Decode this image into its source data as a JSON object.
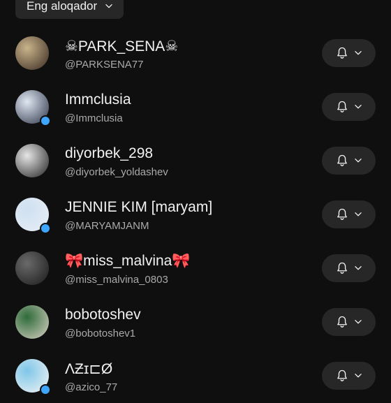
{
  "sort": {
    "label": "Eng aloqador"
  },
  "channels": [
    {
      "name": "☠PARK_SENA☠",
      "handle": "@PARKSENA77",
      "has_dot": false,
      "avatar_colors": [
        "#c9b48a",
        "#3a2a22"
      ]
    },
    {
      "name": "Immclusia",
      "handle": "@Immclusia",
      "has_dot": true,
      "avatar_colors": [
        "#dfe7f2",
        "#2c3346"
      ]
    },
    {
      "name": "diyorbek_298",
      "handle": "@diyorbek_yoldashev",
      "has_dot": false,
      "avatar_colors": [
        "#e6e6e6",
        "#222222"
      ]
    },
    {
      "name": "JENNIE KIM [maryam]",
      "handle": "@MARYAMJANM",
      "has_dot": true,
      "avatar_colors": [
        "#cfe0f0",
        "#e8eef6"
      ]
    },
    {
      "name": "🎀miss_malvina🎀",
      "handle": "@miss_malvina_0803",
      "has_dot": false,
      "avatar_colors": [
        "#6a6a6a",
        "#1a1a1a"
      ]
    },
    {
      "name": "bobotoshev",
      "handle": "@bobotoshev1",
      "has_dot": false,
      "avatar_colors": [
        "#2f6b3a",
        "#d8d2c4"
      ]
    },
    {
      "name": "ΛƵɪ⊏Ø",
      "handle": "@azico_77",
      "has_dot": true,
      "avatar_colors": [
        "#7ec6e8",
        "#f4f4f4"
      ]
    }
  ],
  "icons": {
    "bell": "bell-icon",
    "chevron": "chevron-down-icon"
  },
  "colors": {
    "background": "#0f0f0f",
    "chip": "#272727",
    "secondary_text": "#aaaaaa",
    "live_dot": "#3ea6ff"
  }
}
